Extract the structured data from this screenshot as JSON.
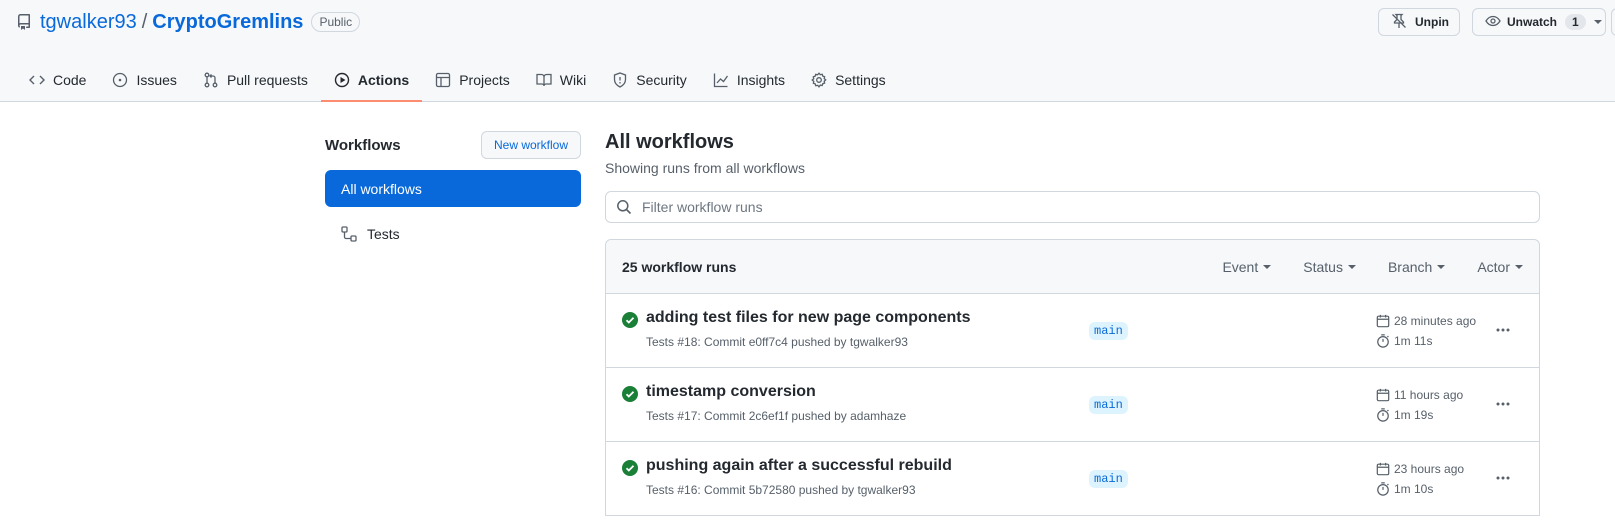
{
  "repo": {
    "owner": "tgwalker93",
    "separator": "/",
    "name": "CryptoGremlins",
    "visibility": "Public"
  },
  "header_actions": {
    "unpin_label": "Unpin",
    "unwatch_label": "Unwatch",
    "watch_count": "1"
  },
  "tabs": [
    {
      "label": "Code",
      "icon": "code-icon"
    },
    {
      "label": "Issues",
      "icon": "issue-opened-icon"
    },
    {
      "label": "Pull requests",
      "icon": "git-pull-request-icon"
    },
    {
      "label": "Actions",
      "icon": "play-icon",
      "active": true
    },
    {
      "label": "Projects",
      "icon": "table-icon"
    },
    {
      "label": "Wiki",
      "icon": "book-icon"
    },
    {
      "label": "Security",
      "icon": "shield-icon"
    },
    {
      "label": "Insights",
      "icon": "graph-icon"
    },
    {
      "label": "Settings",
      "icon": "gear-icon"
    }
  ],
  "sidebar": {
    "title": "Workflows",
    "new_workflow_label": "New workflow",
    "items": [
      {
        "label": "All workflows",
        "selected": true
      },
      {
        "label": "Tests",
        "icon": "workflow-icon"
      }
    ]
  },
  "main": {
    "title": "All workflows",
    "subtitle": "Showing runs from all workflows",
    "filter_placeholder": "Filter workflow runs",
    "runs_count": "25 workflow runs",
    "filters": [
      "Event",
      "Status",
      "Branch",
      "Actor"
    ],
    "runs": [
      {
        "title": "adding test files for new page components",
        "meta": "Tests #18: Commit e0ff7c4 pushed by tgwalker93",
        "branch": "main",
        "time": "28 minutes ago",
        "duration": "1m 11s",
        "status": "success"
      },
      {
        "title": "timestamp conversion",
        "meta": "Tests #17: Commit 2c6ef1f pushed by adamhaze",
        "branch": "main",
        "time": "11 hours ago",
        "duration": "1m 19s",
        "status": "success"
      },
      {
        "title": "pushing again after a successful rebuild",
        "meta": "Tests #16: Commit 5b72580 pushed by tgwalker93",
        "branch": "main",
        "time": "23 hours ago",
        "duration": "1m 10s",
        "status": "success"
      }
    ]
  },
  "colors": {
    "accent": "#0969da",
    "success": "#1a7f37",
    "tab_underline": "#fd8c73",
    "header_bg": "#f6f8fa"
  }
}
